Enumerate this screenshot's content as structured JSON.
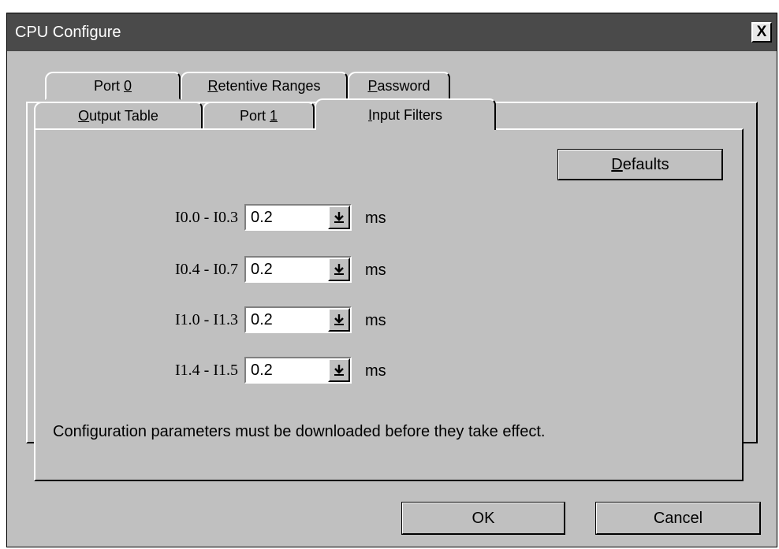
{
  "window": {
    "title": "CPU Configure",
    "close_label": "X"
  },
  "tabs_back": [
    {
      "prefix": "Port ",
      "accel": "0",
      "suffix": ""
    },
    {
      "prefix": "",
      "accel": "R",
      "suffix": "etentive Ranges"
    },
    {
      "prefix": "",
      "accel": "P",
      "suffix": "assword"
    }
  ],
  "tabs_front": [
    {
      "prefix": "",
      "accel": "O",
      "suffix": "utput Table"
    },
    {
      "prefix": "Port ",
      "accel": "1",
      "suffix": ""
    },
    {
      "prefix": "",
      "accel": "I",
      "suffix": "nput Filters",
      "active": true
    }
  ],
  "defaults_button": {
    "accel": "D",
    "suffix": "efaults"
  },
  "filters": [
    {
      "label": "I0.0 - I0.3",
      "value": "0.2",
      "unit": "ms"
    },
    {
      "label": "I0.4 - I0.7",
      "value": "0.2",
      "unit": "ms"
    },
    {
      "label": "I1.0 - I1.3",
      "value": "0.2",
      "unit": "ms"
    },
    {
      "label": "I1.4 - I1.5",
      "value": "0.2",
      "unit": "ms"
    }
  ],
  "note": "Configuration parameters must be downloaded before they take effect.",
  "buttons": {
    "ok": "OK",
    "cancel": "Cancel"
  },
  "colors": {
    "title_bar": "#4a4a4a",
    "dialog_bg": "#c0c0c0"
  }
}
